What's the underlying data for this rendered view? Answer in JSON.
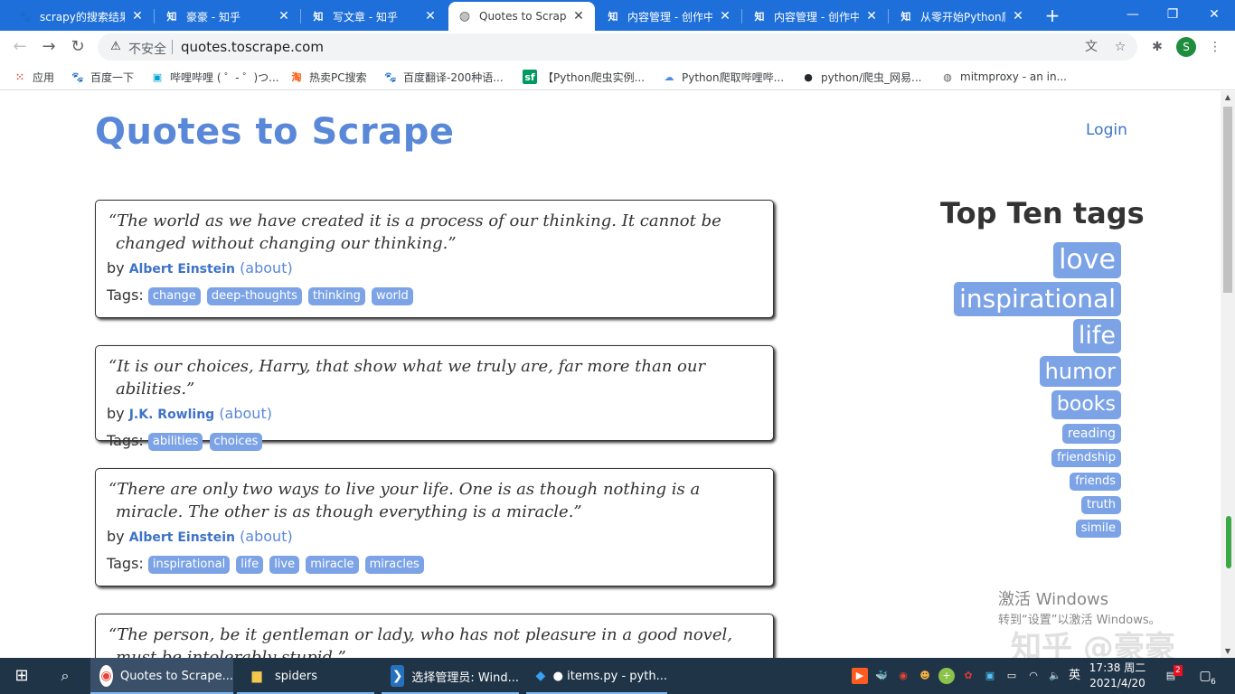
{
  "browser": {
    "tabs": [
      {
        "title": "scrapy的搜索结果",
        "icon": "paw-icon",
        "icon_glyph": "🐾",
        "icon_color": "#2932e1"
      },
      {
        "title": "豪豪 - 知乎",
        "icon": "zhihu-icon",
        "icon_glyph": "知",
        "icon_color": "#0066ff"
      },
      {
        "title": "写文章 - 知乎",
        "icon": "zhihu-icon",
        "icon_glyph": "知",
        "icon_color": "#0066ff"
      },
      {
        "title": "Quotes to Scrape",
        "icon": "globe-icon",
        "icon_glyph": "◍",
        "icon_color": "#5f6368"
      },
      {
        "title": "内容管理 - 创作中心",
        "icon": "zhihu-icon",
        "icon_glyph": "知",
        "icon_color": "#0066ff"
      },
      {
        "title": "内容管理 - 创作中心",
        "icon": "zhihu-icon",
        "icon_glyph": "知",
        "icon_color": "#0066ff"
      },
      {
        "title": "从零开始Python爬虫",
        "icon": "zhihu-icon",
        "icon_glyph": "知",
        "icon_color": "#0066ff"
      }
    ],
    "active_tab": 3,
    "not_secure_label": "不安全",
    "url": "quotes.toscrape.com",
    "profile_initial": "S",
    "bookmarks": [
      {
        "label": "应用",
        "icon": "apps-grid-icon",
        "glyph": "⋮⋮",
        "color": "#ea4335"
      },
      {
        "label": "百度一下",
        "icon": "baidu-paw-icon",
        "glyph": "🐾",
        "color": "#2932e1"
      },
      {
        "label": "哔哩哔哩 ( ゜- ゜)つ...",
        "icon": "bilibili-icon",
        "glyph": "▣",
        "color": "#00a1d6"
      },
      {
        "label": "热卖PC搜索",
        "icon": "taobao-icon",
        "glyph": "淘",
        "color": "#ff5000"
      },
      {
        "label": "百度翻译-200种语...",
        "icon": "baidu-paw-icon",
        "glyph": "🐾",
        "color": "#2932e1"
      },
      {
        "label": "【Python爬虫实例...",
        "icon": "segmentfault-icon",
        "glyph": "sf",
        "color": "#009a61"
      },
      {
        "label": "Python爬取哔哩哔...",
        "icon": "cloud-icon",
        "glyph": "☁",
        "color": "#4e8be8"
      },
      {
        "label": "python/爬虫_网易...",
        "icon": "github-icon",
        "glyph": "●",
        "color": "#24292e"
      },
      {
        "label": "mitmproxy - an in...",
        "icon": "globe-icon",
        "glyph": "◍",
        "color": "#5f6368"
      }
    ]
  },
  "site": {
    "title": "Quotes to Scrape",
    "login_label": "Login",
    "by_label": "by",
    "about_label": "(about)",
    "tags_label": "Tags:",
    "quotes": [
      {
        "text": "“The world as we have created it is a process of our thinking. It cannot be changed without changing our thinking.”",
        "author": "Albert Einstein",
        "tags": [
          "change",
          "deep-thoughts",
          "thinking",
          "world"
        ]
      },
      {
        "text": "“It is our choices, Harry, that show what we truly are, far more than our abilities.”",
        "author": "J.K. Rowling",
        "tags": [
          "abilities",
          "choices"
        ]
      },
      {
        "text": "“There are only two ways to live your life. One is as though nothing is a miracle. The other is as though everything is a miracle.”",
        "author": "Albert Einstein",
        "tags": [
          "inspirational",
          "life",
          "live",
          "miracle",
          "miracles"
        ]
      },
      {
        "text": "“The person, be it gentleman or lady, who has not pleasure in a good novel, must be intolerably stupid.”",
        "author": "",
        "tags": []
      }
    ],
    "top_tags_title": "Top Ten tags",
    "top_tags": [
      "love",
      "inspirational",
      "life",
      "humor",
      "books",
      "reading",
      "friendship",
      "friends",
      "truth",
      "simile"
    ]
  },
  "overlay": {
    "activate_line1": "激活 Windows",
    "activate_line2": "转到“设置”以激活 Windows。",
    "watermark": "知乎 @豪豪"
  },
  "taskbar": {
    "apps": [
      {
        "label": "Quotes to Scrape...",
        "icon": "chrome-icon",
        "glyph": "◉",
        "color": "#ea4335",
        "active": true
      },
      {
        "label": "spiders",
        "icon": "folder-icon",
        "glyph": "▆",
        "color": "#f2c94c",
        "active": false
      },
      {
        "label": "选择管理员: Wind...",
        "icon": "powershell-icon",
        "glyph": "❯",
        "color": "#2671be",
        "active": false
      },
      {
        "label": "● items.py - pyth...",
        "icon": "vscode-icon",
        "glyph": "◆",
        "color": "#0078d4",
        "active": false
      }
    ],
    "input_method": "英",
    "time": "17:38 周二",
    "date": "2021/4/20",
    "notification_count": "6",
    "tray_badge": "2"
  },
  "colors": {
    "chrome_tab_strip": "#1e6fd9",
    "site_title": "#5a88d8",
    "tag_bg": "#7ca3e6",
    "link": "#3e73c7",
    "taskbar_bg": "#203447"
  }
}
